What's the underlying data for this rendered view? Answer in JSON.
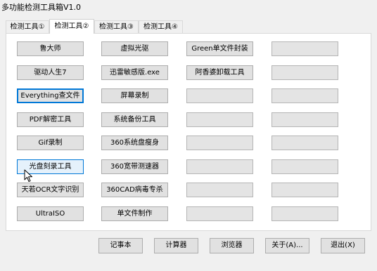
{
  "window": {
    "title": "多功能检测工具箱V1.0"
  },
  "tabs": [
    {
      "label": "检测工具①"
    },
    {
      "label": "检测工具②"
    },
    {
      "label": "检测工具③"
    },
    {
      "label": "检测工具④"
    }
  ],
  "active_tab": 1,
  "buttons": {
    "col1": [
      "鲁大师",
      "驱动人生7",
      "Everything查文件",
      "PDF解密工具",
      "Gif录制",
      "光盘刻录工具",
      "天若OCR文字识别",
      "UltraISO"
    ],
    "col2": [
      "虚拟光驱",
      "迅雷敏感版.exe",
      "屏幕录制",
      "系统备份工具",
      "360系统盘瘦身",
      "360宽带测速器",
      "360CAD病毒专杀",
      "单文件制作"
    ],
    "col3": [
      "Green单文件封装",
      "阿香婆卸载工具",
      "",
      "",
      "",
      "",
      "",
      ""
    ],
    "col4": [
      "",
      "",
      "",
      "",
      "",
      "",
      "",
      ""
    ]
  },
  "bottom": {
    "notepad": "记事本",
    "calculator": "计算器",
    "browser": "浏览器",
    "about": "关于(A)...",
    "exit": "退出(X)"
  }
}
